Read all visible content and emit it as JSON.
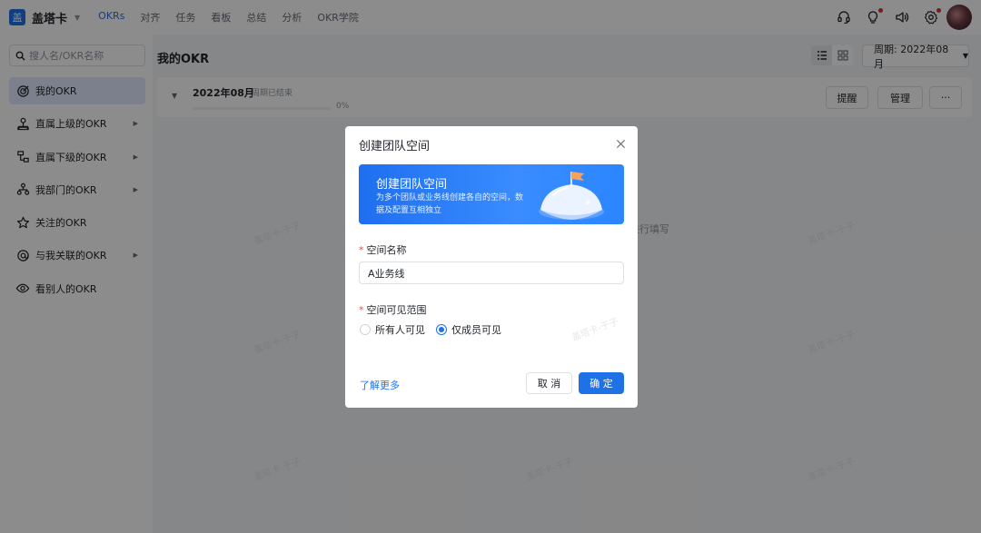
{
  "app": {
    "logo_char": "盖",
    "name": "盖塔卡",
    "caret": "▼"
  },
  "nav": {
    "items": [
      {
        "label": "OKRs",
        "active": true
      },
      {
        "label": "对齐",
        "active": false
      },
      {
        "label": "任务",
        "active": false
      },
      {
        "label": "看板",
        "active": false
      },
      {
        "label": "总结",
        "active": false
      },
      {
        "label": "分析",
        "active": false
      },
      {
        "label": "OKR学院",
        "active": false
      }
    ]
  },
  "top_icons": [
    "headset-icon",
    "lightbulb-icon",
    "speaker-icon",
    "gear-icon"
  ],
  "sidebar": {
    "search_placeholder": "搜人名/OKR名称",
    "items": [
      {
        "label": "我的OKR",
        "icon": "target-icon",
        "active": true,
        "has_arrow": false
      },
      {
        "label": "直属上级的OKR",
        "icon": "org-up-icon",
        "active": false,
        "has_arrow": true
      },
      {
        "label": "直属下级的OKR",
        "icon": "org-down-icon",
        "active": false,
        "has_arrow": true
      },
      {
        "label": "我部门的OKR",
        "icon": "department-icon",
        "active": false,
        "has_arrow": true
      },
      {
        "label": "关注的OKR",
        "icon": "star-icon",
        "active": false,
        "has_arrow": false
      },
      {
        "label": "与我关联的OKR",
        "icon": "link-icon",
        "active": false,
        "has_arrow": true
      },
      {
        "label": "看别人的OKR",
        "icon": "eye-icon",
        "active": false,
        "has_arrow": false
      }
    ]
  },
  "main": {
    "title": "我的OKR",
    "period_label": "周期: 2022年08月",
    "period_caret": "▼",
    "card": {
      "date": "2022年08月",
      "status": "周期已结束",
      "progress_pct": 0,
      "progress_text": "0%",
      "buttons": [
        "提醒",
        "管理",
        "···"
      ]
    },
    "empty_hint": "进行填写"
  },
  "watermark_text": "盖塔卡-于子",
  "modal": {
    "title": "创建团队空间",
    "banner": {
      "title": "创建团队空间",
      "desc": "为多个团队或业务线创建各自的空间，数据及配置互相独立"
    },
    "name_label": "空间名称",
    "name_value": "A业务线",
    "scope_label": "空间可见范围",
    "required_mark": "*",
    "radio_options": [
      {
        "label": "所有人可见",
        "checked": false
      },
      {
        "label": "仅成员可见",
        "checked": true
      }
    ],
    "learn_more": "了解更多",
    "cancel": "取 消",
    "ok": "确 定"
  },
  "colors": {
    "accent": "#1f72e6",
    "required": "#f54a45",
    "notify_dot": "#e22e28"
  }
}
